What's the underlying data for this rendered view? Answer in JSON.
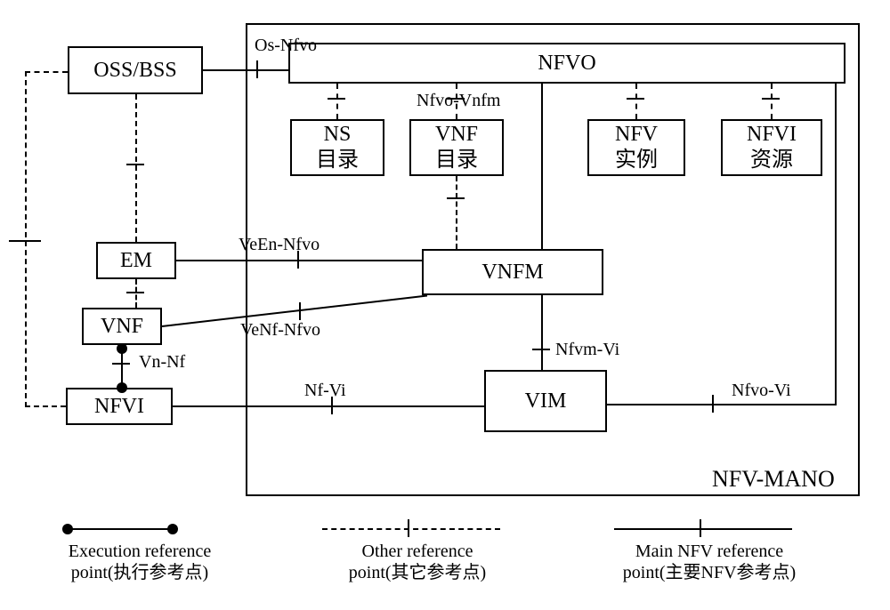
{
  "boxes": {
    "oss_bss": "OSS/BSS",
    "nfvo": "NFVO",
    "ns_catalog_l1": "NS",
    "ns_catalog_l2": "目录",
    "vnf_catalog_l1": "VNF",
    "vnf_catalog_l2": "目录",
    "nfv_instance_l1": "NFV",
    "nfv_instance_l2": "实例",
    "nfvi_resource_l1": "NFVI",
    "nfvi_resource_l2": "资源",
    "em": "EM",
    "vnf": "VNF",
    "nfvi": "NFVI",
    "vnfm": "VNFM",
    "vim": "VIM"
  },
  "labels": {
    "mano": "NFV-MANO",
    "os_nfvo": "Os-Nfvo",
    "nfvo_vnfm": "Nfvo-Vnfm",
    "ve_en_nfvo": "VeEn-Nfvo",
    "ve_nf_nfvo": "VeNf-Nfvo",
    "vn_nf": "Vn-Nf",
    "nf_vi": "Nf-Vi",
    "nfvm_vi": "Nfvm-Vi",
    "nfvo_vi": "Nfvo-Vi"
  },
  "legend": {
    "exec_l1": "Execution reference",
    "exec_l2": "point(执行参考点)",
    "other_l1": "Other reference",
    "other_l2": "point(其它参考点)",
    "main_l1": "Main NFV reference",
    "main_l2": "point(主要NFV参考点)"
  }
}
